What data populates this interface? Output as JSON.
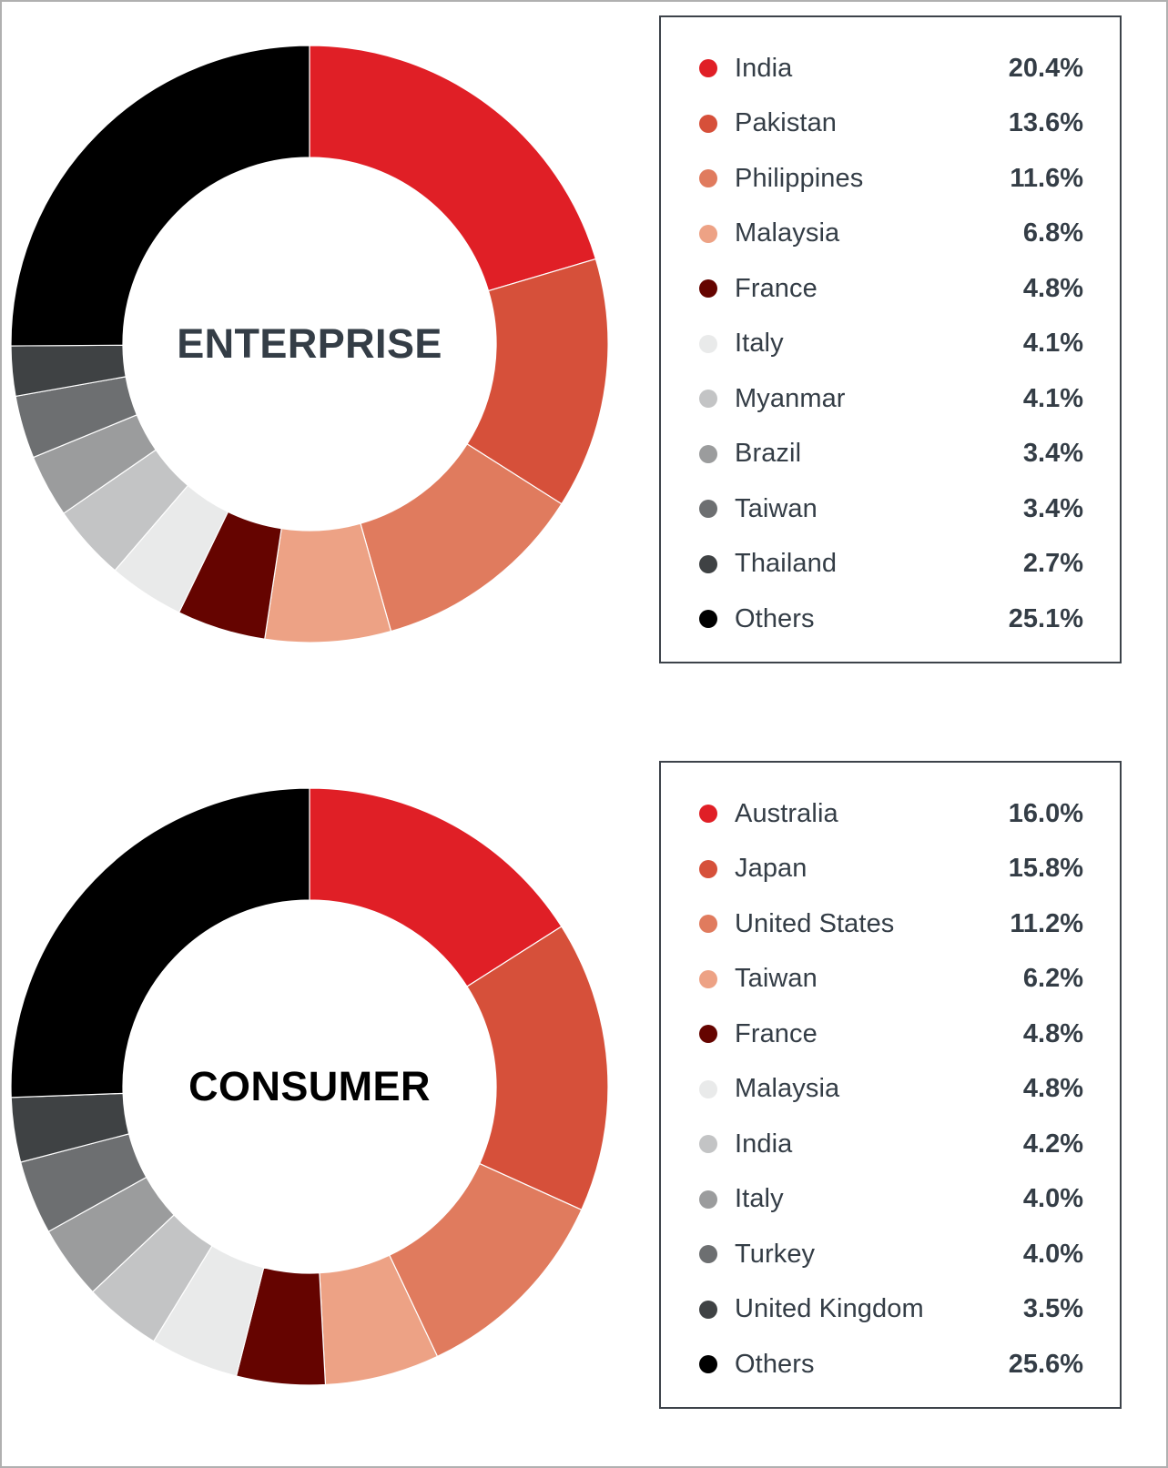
{
  "chart_data": [
    {
      "type": "pie",
      "title": "ENTERPRISE",
      "center_label": "ENTERPRISE",
      "subtitle": "",
      "xlabel": "",
      "ylabel": "",
      "legend_position": "right",
      "grid": false,
      "donut": true,
      "start_angle_deg": 0,
      "direction": "clockwise",
      "unit": "%",
      "categories": [
        "India",
        "Pakistan",
        "Philippines",
        "Malaysia",
        "France",
        "Italy",
        "Myanmar",
        "Brazil",
        "Taiwan",
        "Thailand",
        "Others"
      ],
      "values": [
        20.4,
        13.6,
        11.6,
        6.8,
        4.8,
        4.1,
        4.1,
        3.4,
        3.4,
        2.7,
        25.1
      ],
      "value_labels": [
        "20.4%",
        "13.6%",
        "11.6%",
        "6.8%",
        "4.8%",
        "4.1%",
        "4.1%",
        "3.4%",
        "3.4%",
        "2.7%",
        "25.1%"
      ],
      "colors": [
        "#e01f26",
        "#d6503a",
        "#e07b5e",
        "#eda285",
        "#650400",
        "#e9eaea",
        "#c3c4c5",
        "#9b9c9d",
        "#6d6f71",
        "#3f4244",
        "#000000"
      ],
      "slices": [
        {
          "label": "India",
          "value": 20.4,
          "value_label": "20.4%",
          "color": "#e01f26"
        },
        {
          "label": "Pakistan",
          "value": 13.6,
          "value_label": "13.6%",
          "color": "#d6503a"
        },
        {
          "label": "Philippines",
          "value": 11.6,
          "value_label": "11.6%",
          "color": "#e07b5e"
        },
        {
          "label": "Malaysia",
          "value": 6.8,
          "value_label": "6.8%",
          "color": "#eda285"
        },
        {
          "label": "France",
          "value": 4.8,
          "value_label": "4.8%",
          "color": "#650400"
        },
        {
          "label": "Italy",
          "value": 4.1,
          "value_label": "4.1%",
          "color": "#e9eaea"
        },
        {
          "label": "Myanmar",
          "value": 4.1,
          "value_label": "4.1%",
          "color": "#c3c4c5"
        },
        {
          "label": "Brazil",
          "value": 3.4,
          "value_label": "3.4%",
          "color": "#9b9c9d"
        },
        {
          "label": "Taiwan",
          "value": 3.4,
          "value_label": "3.4%",
          "color": "#6d6f71"
        },
        {
          "label": "Thailand",
          "value": 2.7,
          "value_label": "2.7%",
          "color": "#3f4244"
        },
        {
          "label": "Others",
          "value": 25.1,
          "value_label": "25.1%",
          "color": "#000000"
        }
      ]
    },
    {
      "type": "pie",
      "title": "CONSUMER",
      "center_label": "CONSUMER",
      "subtitle": "",
      "xlabel": "",
      "ylabel": "",
      "legend_position": "right",
      "grid": false,
      "donut": true,
      "start_angle_deg": 0,
      "direction": "clockwise",
      "unit": "%",
      "categories": [
        "Australia",
        "Japan",
        "United States",
        "Taiwan",
        "France",
        "Malaysia",
        "India",
        "Italy",
        "Turkey",
        "United Kingdom",
        "Others"
      ],
      "values": [
        16.0,
        15.8,
        11.2,
        6.2,
        4.8,
        4.8,
        4.2,
        4.0,
        4.0,
        3.5,
        25.6
      ],
      "value_labels": [
        "16.0%",
        "15.8%",
        "11.2%",
        "6.2%",
        "4.8%",
        "4.8%",
        "4.2%",
        "4.0%",
        "4.0%",
        "3.5%",
        "25.6%"
      ],
      "colors": [
        "#e01f26",
        "#d6503a",
        "#e07b5e",
        "#eda285",
        "#650400",
        "#e9eaea",
        "#c3c4c5",
        "#9b9c9d",
        "#6d6f71",
        "#3f4244",
        "#000000"
      ],
      "slices": [
        {
          "label": "Australia",
          "value": 16.0,
          "value_label": "16.0%",
          "color": "#e01f26"
        },
        {
          "label": "Japan",
          "value": 15.8,
          "value_label": "15.8%",
          "color": "#d6503a"
        },
        {
          "label": "United States",
          "value": 11.2,
          "value_label": "11.2%",
          "color": "#e07b5e"
        },
        {
          "label": "Taiwan",
          "value": 6.2,
          "value_label": "6.2%",
          "color": "#eda285"
        },
        {
          "label": "France",
          "value": 4.8,
          "value_label": "4.8%",
          "color": "#650400"
        },
        {
          "label": "Malaysia",
          "value": 4.8,
          "value_label": "4.8%",
          "color": "#e9eaea"
        },
        {
          "label": "India",
          "value": 4.2,
          "value_label": "4.2%",
          "color": "#c3c4c5"
        },
        {
          "label": "Italy",
          "value": 4.0,
          "value_label": "4.0%",
          "color": "#9b9c9d"
        },
        {
          "label": "Turkey",
          "value": 4.0,
          "value_label": "4.0%",
          "color": "#6d6f71"
        },
        {
          "label": "United Kingdom",
          "value": 3.5,
          "value_label": "3.5%",
          "color": "#3f4244"
        },
        {
          "label": "Others",
          "value": 25.6,
          "value_label": "25.6%",
          "color": "#000000"
        }
      ]
    }
  ],
  "theme": {
    "accent": "#e01f26",
    "text": "#343d46",
    "legend_border": "#3d434a",
    "page_border": "#b0b0b0",
    "background": "#ffffff"
  }
}
